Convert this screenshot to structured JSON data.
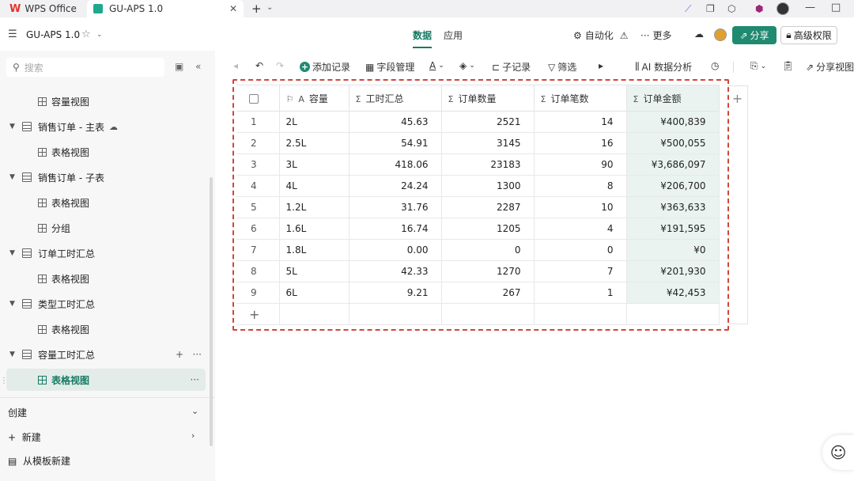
{
  "window": {
    "tabs": [
      {
        "label": "WPS Office",
        "icon": "wps-logo-icon"
      },
      {
        "label": "GU-APS 1.0",
        "icon": "app-logo-icon",
        "active": true
      }
    ]
  },
  "header": {
    "title": "GU-APS 1.0",
    "tabs": [
      {
        "label": "数据",
        "active": true
      },
      {
        "label": "应用"
      }
    ],
    "actions": {
      "automation": "自动化",
      "more": "更多",
      "share": "分享",
      "permission": "高级权限"
    }
  },
  "sidebar": {
    "search_placeholder": "搜索",
    "items": [
      {
        "label": "容量视图",
        "kind": "view"
      },
      {
        "label": "销售订单 - 主表",
        "kind": "table",
        "icon": "cloud-icon"
      },
      {
        "label": "表格视图",
        "kind": "view"
      },
      {
        "label": "销售订单 - 子表",
        "kind": "table"
      },
      {
        "label": "表格视图",
        "kind": "view"
      },
      {
        "label": "分组",
        "kind": "view"
      },
      {
        "label": "订单工时汇总",
        "kind": "table"
      },
      {
        "label": "表格视图",
        "kind": "view"
      },
      {
        "label": "类型工时汇总",
        "kind": "table"
      },
      {
        "label": "表格视图",
        "kind": "view"
      },
      {
        "label": "容量工时汇总",
        "kind": "table"
      },
      {
        "label": "表格视图",
        "kind": "view",
        "selected": true
      }
    ],
    "create_section": "创建",
    "new_label": "新建",
    "template_label": "从模板新建"
  },
  "toolbar": {
    "add_record": "添加记录",
    "field_manage": "字段管理",
    "sub_record": "子记录",
    "filter": "筛选",
    "ai_analysis": "AI 数据分析",
    "share_view": "分享视图"
  },
  "grid": {
    "columns": [
      "容量",
      "工时汇总",
      "订单数量",
      "订单笔数",
      "订单金额"
    ],
    "rows": [
      {
        "n": "1",
        "cap": "2L",
        "hours": "45.63",
        "qty": "2521",
        "count": "14",
        "amount": "¥400,839"
      },
      {
        "n": "2",
        "cap": "2.5L",
        "hours": "54.91",
        "qty": "3145",
        "count": "16",
        "amount": "¥500,055"
      },
      {
        "n": "3",
        "cap": "3L",
        "hours": "418.06",
        "qty": "23183",
        "count": "90",
        "amount": "¥3,686,097"
      },
      {
        "n": "4",
        "cap": "4L",
        "hours": "24.24",
        "qty": "1300",
        "count": "8",
        "amount": "¥206,700"
      },
      {
        "n": "5",
        "cap": "1.2L",
        "hours": "31.76",
        "qty": "2287",
        "count": "10",
        "amount": "¥363,633"
      },
      {
        "n": "6",
        "cap": "1.6L",
        "hours": "16.74",
        "qty": "1205",
        "count": "4",
        "amount": "¥191,595"
      },
      {
        "n": "7",
        "cap": "1.8L",
        "hours": "0.00",
        "qty": "0",
        "count": "0",
        "amount": "¥0"
      },
      {
        "n": "8",
        "cap": "5L",
        "hours": "42.33",
        "qty": "1270",
        "count": "7",
        "amount": "¥201,930"
      },
      {
        "n": "9",
        "cap": "6L",
        "hours": "9.21",
        "qty": "267",
        "count": "1",
        "amount": "¥42,453"
      }
    ]
  },
  "colors": {
    "accent": "#1f8a70",
    "highlight_border": "#d0453a",
    "selected_column": "#eaf3ef"
  }
}
